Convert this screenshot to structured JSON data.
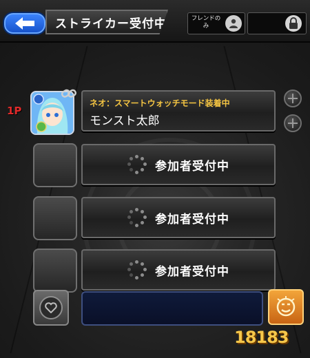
{
  "header": {
    "title": "ストライカー受付中",
    "friend_only_label": "フレンドのみ"
  },
  "players": [
    {
      "slot_label": "1P",
      "device_note": "ネオ：スマートウォッチモード装着中",
      "name": "モンスト太郎"
    },
    {
      "status": "参加者受付中"
    },
    {
      "status": "参加者受付中"
    },
    {
      "status": "参加者受付中"
    }
  ],
  "watermark": "18183",
  "colors": {
    "accent_blue": "#2a6cf0",
    "status_gold": "#f5c542",
    "p1_red": "#e02a2a",
    "chat_orange": "#e08a2a"
  }
}
